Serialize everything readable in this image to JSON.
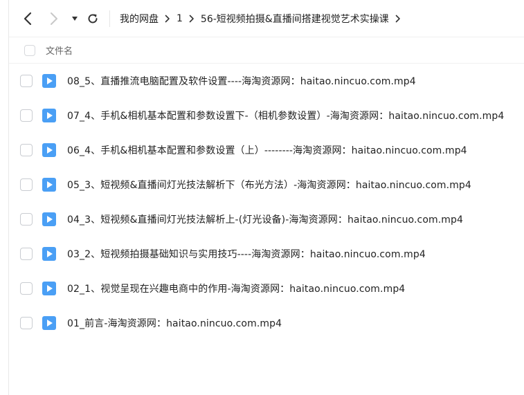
{
  "toolbar": {
    "back_icon": "chevron-left-icon",
    "forward_icon": "chevron-right-icon",
    "history_icon": "caret-down-icon",
    "refresh_icon": "refresh-icon"
  },
  "breadcrumb": {
    "items": [
      "我的网盘",
      "1",
      "56-短视频拍摄&直播间搭建视觉艺术实操课"
    ],
    "separator_icon": "chevron-right-icon"
  },
  "list_header": {
    "name_label": "文件名"
  },
  "files": [
    {
      "name": "08_5、直播推流电脑配置及软件设置----海淘资源网：haitao.nincuo.com.mp4",
      "icon": "video-file-icon"
    },
    {
      "name": "07_4、手机&相机基本配置和参数设置下-（相机参数设置）-海淘资源网：haitao.nincuo.com.mp4",
      "icon": "video-file-icon"
    },
    {
      "name": "06_4、手机&相机基本配置和参数设置（上）--------海淘资源网：haitao.nincuo.com.mp4",
      "icon": "video-file-icon"
    },
    {
      "name": "05_3、短视频&直播间灯光技法解析下（布光方法）-海淘资源网：haitao.nincuo.com.mp4",
      "icon": "video-file-icon"
    },
    {
      "name": "04_3、短视频&直播间灯光技法解析上-(灯光设备)-海淘资源网：haitao.nincuo.com.mp4",
      "icon": "video-file-icon"
    },
    {
      "name": "03_2、短视频拍摄基础知识与实用技巧----海淘资源网：haitao.nincuo.com.mp4",
      "icon": "video-file-icon"
    },
    {
      "name": "02_1、视觉呈现在兴趣电商中的作用-海淘资源网：haitao.nincuo.com.mp4",
      "icon": "video-file-icon"
    },
    {
      "name": "01_前言-海淘资源网：haitao.nincuo.com.mp4",
      "icon": "video-file-icon"
    }
  ],
  "colors": {
    "video_icon": "#4a9ff5",
    "nav_active": "#333333",
    "nav_disabled": "#c8c8c8"
  }
}
